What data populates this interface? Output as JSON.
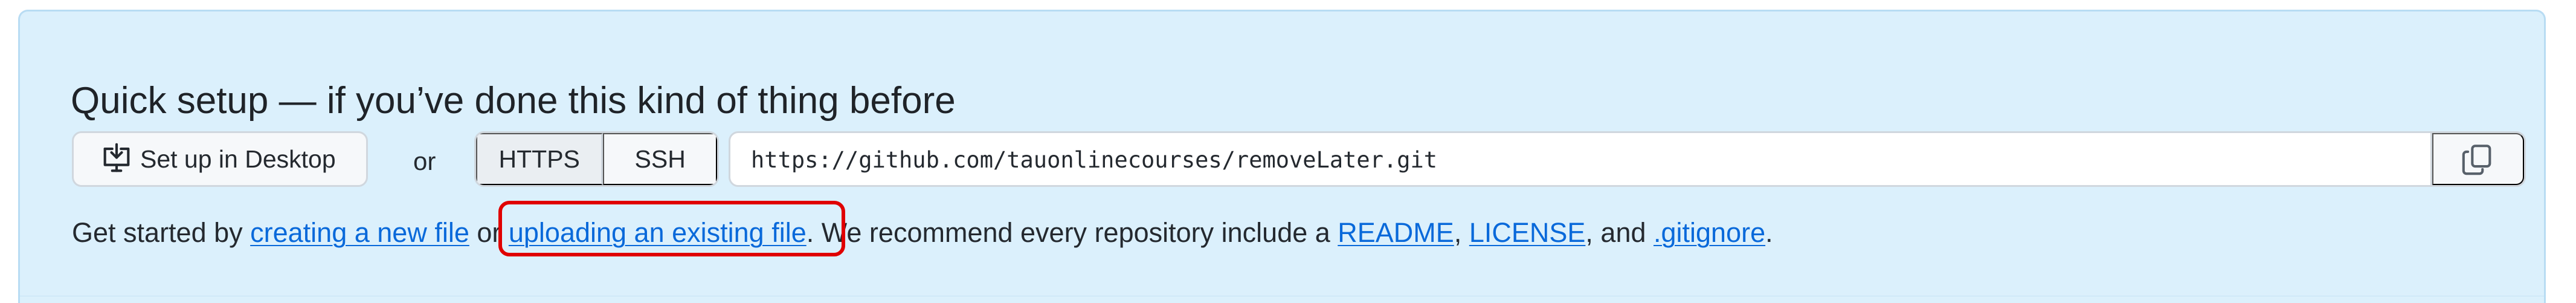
{
  "quick_setup": {
    "title": "Quick setup — if you’ve done this kind of thing before",
    "desktop_button": "Set up in Desktop",
    "or_text": "or",
    "protocols": {
      "https": "HTTPS",
      "ssh": "SSH",
      "selected": "HTTPS"
    },
    "repository_url": "https://github.com/tauonlinecourses/removeLater.git",
    "instructions": {
      "prefix": "Get started by ",
      "create_file_link": "creating a new file",
      "or_text": " or ",
      "upload_link": "uploading an existing file",
      "recommendation": ". We recommend every repository include a ",
      "readme_link": "README",
      "comma": ", ",
      "license_link": "LICENSE",
      "and_text": ", and ",
      "gitignore_link": ".gitignore",
      "period": "."
    }
  },
  "icons": {
    "desktop": "desktop-download-icon",
    "copy": "copy-icon"
  },
  "colors": {
    "panel_background": "#dbf0fc",
    "link": "#0969da",
    "highlight": "#e00000"
  }
}
